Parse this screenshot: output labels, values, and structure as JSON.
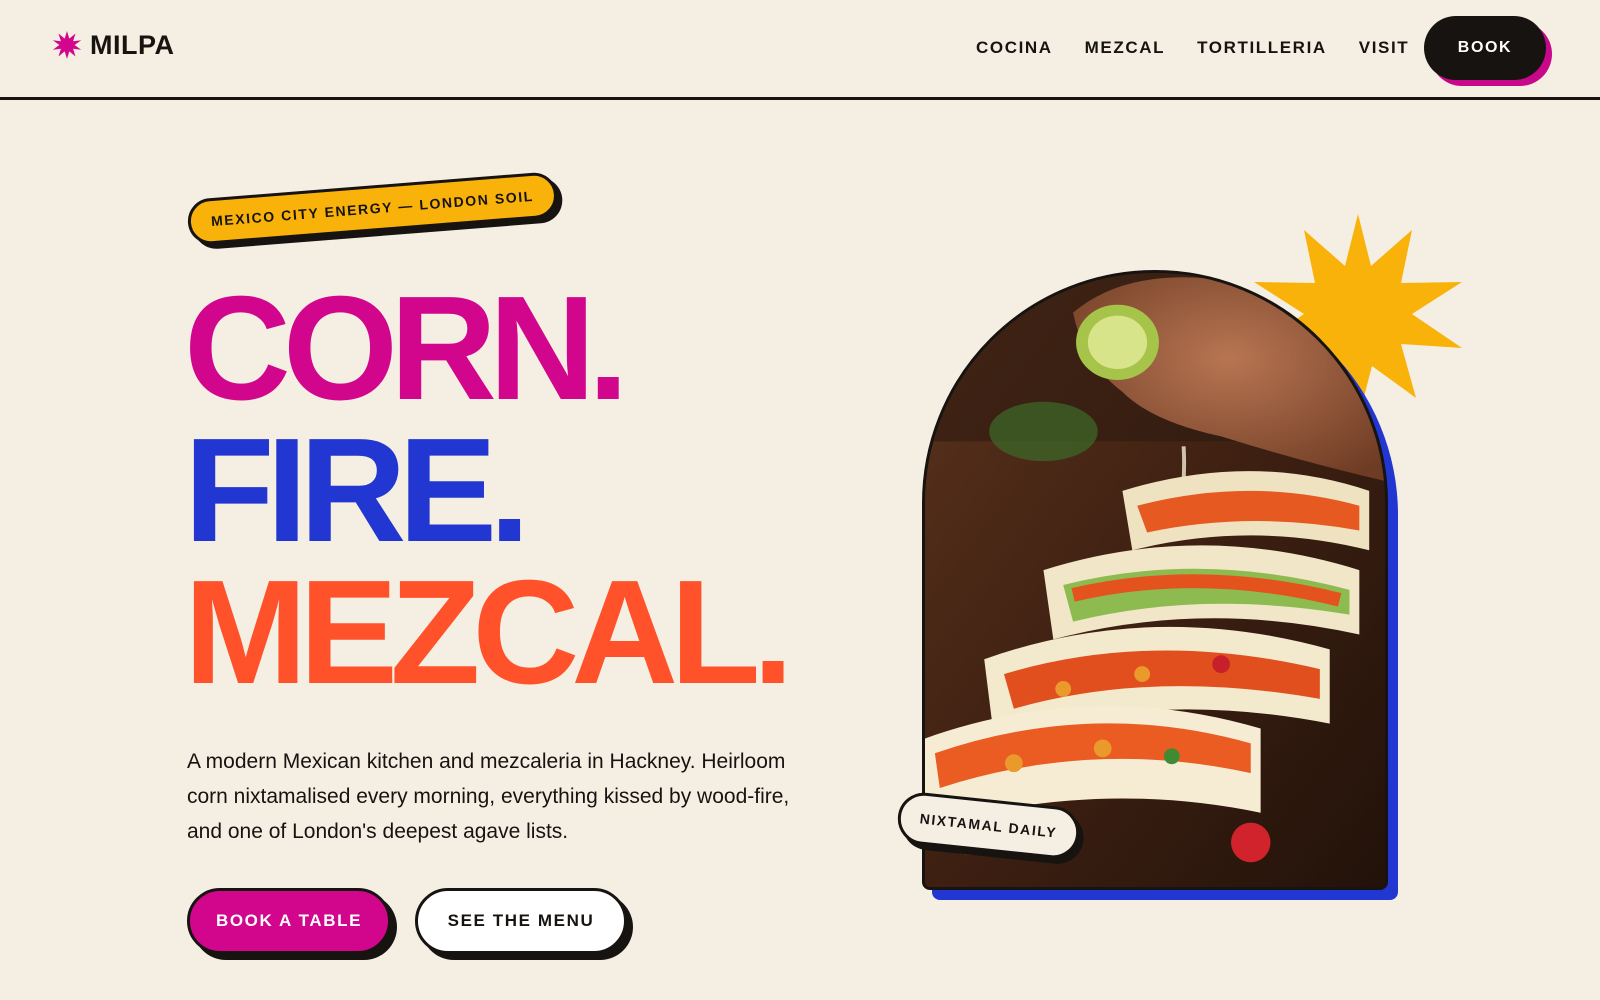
{
  "brand": {
    "name": "MILPA",
    "logo_icon": "magenta-starburst-icon",
    "accent": "#d1068c"
  },
  "nav": {
    "links": [
      "COCINA",
      "MEZCAL",
      "TORTILLERIA",
      "VISIT"
    ],
    "book_label": "BOOK"
  },
  "hero": {
    "tag": "MEXICO CITY ENERGY — LONDON SOIL",
    "headline": [
      {
        "text": "CORN.",
        "color": "#d1068c"
      },
      {
        "text": "FIRE.",
        "color": "#2237d1"
      },
      {
        "text": "MEZCAL.",
        "color": "#ff522a"
      }
    ],
    "intro": "A modern Mexican kitchen and mezcaleria in Hackney. Heirloom corn nixtamalised every morning, everything kissed by wood-fire, and one of London's deepest agave lists.",
    "cta_primary": "BOOK A TABLE",
    "cta_secondary": "SEE THE MENU",
    "image_sticker": "NIXTAMAL DAILY",
    "image_subject": "tacos-with-lime-squeeze-photo",
    "colors": {
      "background": "#f5efe3",
      "ink": "#171311",
      "yellow": "#f9b20a",
      "blue": "#2237d1",
      "orange": "#ff522a"
    }
  }
}
